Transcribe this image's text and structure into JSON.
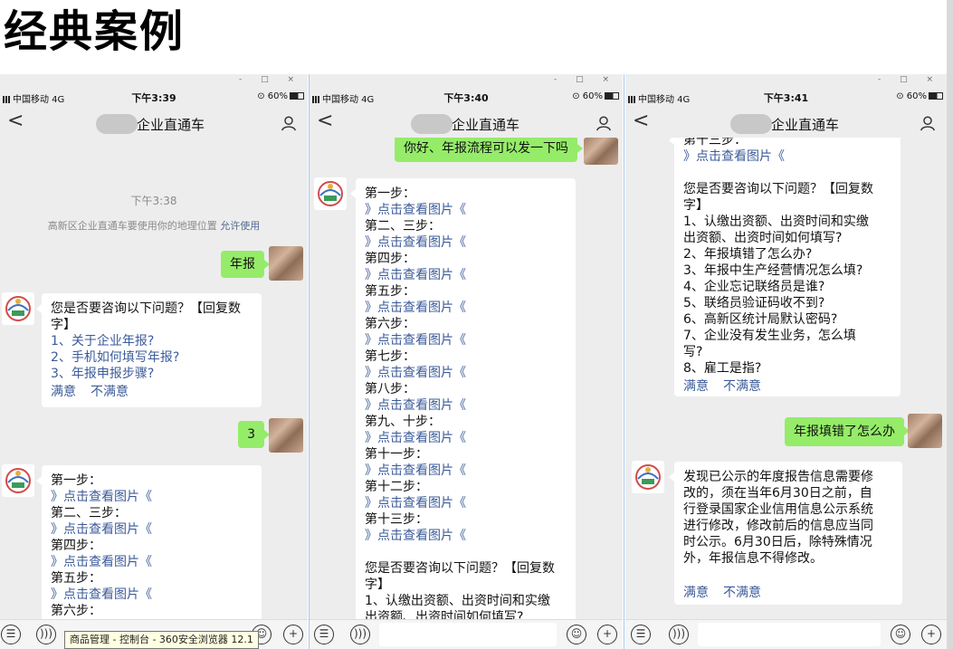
{
  "heading": "经典案例",
  "tooltip": "商品管理 - 控制台 - 360安全浏览器 12.1",
  "window_controls": "-   □   ×",
  "icons": {
    "back": "chevron-left-icon",
    "profile": "person-icon",
    "voice": "voice-icon",
    "menu": "menu-icon",
    "emoji": "emoji-icon",
    "add": "plus-icon"
  },
  "colors": {
    "chat_bg": "#ededed",
    "outgoing_bubble": "#95ec69",
    "link": "#3b5b9a"
  },
  "phones": [
    {
      "carrier": "中国移动  4G",
      "time": "下午3:39",
      "battery": "60%",
      "title": "企业直通车",
      "timestamp": "下午3:38",
      "sysnote": "高新区企业直通车要使用你的地理位置",
      "sysnote_action": "允许使用",
      "msg_out_1": "年报",
      "menu_line_1": "您是否要咨询以下问题？【回复数",
      "menu_line_2": "字】",
      "menu_opt_1": "1、关于企业年报?",
      "menu_opt_2": "2、手机如何填写年报?",
      "menu_opt_3": "3、年报申报步骤?",
      "satisfied": "满意",
      "unsatisfied": "不满意",
      "msg_out_2": "3",
      "steps": [
        {
          "label": "第一步：",
          "link": "》点击查看图片《"
        },
        {
          "label": "第二、三步：",
          "link": "》点击查看图片《"
        },
        {
          "label": "第四步：",
          "link": "》点击查看图片《"
        },
        {
          "label": "第五步：",
          "link": "》点击查看图片《"
        },
        {
          "label": "第六步：",
          "link": ""
        }
      ]
    },
    {
      "carrier": "中国移动  4G",
      "time": "下午3:40",
      "battery": "60%",
      "title": "企业直通车",
      "msg_out_1": "你好、年报流程可以发一下吗",
      "steps": [
        {
          "label": "第一步：",
          "link": "》点击查看图片《"
        },
        {
          "label": "第二、三步：",
          "link": "》点击查看图片《"
        },
        {
          "label": "第四步：",
          "link": "》点击查看图片《"
        },
        {
          "label": "第五步：",
          "link": "》点击查看图片《"
        },
        {
          "label": "第六步：",
          "link": "》点击查看图片《"
        },
        {
          "label": "第七步：",
          "link": "》点击查看图片《"
        },
        {
          "label": "第八步：",
          "link": "》点击查看图片《"
        },
        {
          "label": "第九、十步：",
          "link": "》点击查看图片《"
        },
        {
          "label": "第十一步：",
          "link": "》点击查看图片《"
        },
        {
          "label": "第十二步：",
          "link": "》点击查看图片《"
        },
        {
          "label": "第十三步：",
          "link": "》点击查看图片《"
        }
      ],
      "menu_line_1": "您是否要咨询以下问题？【回复数",
      "menu_line_2": "字】",
      "menu_opt_1a": "1、认缴出资额、出资时间和实缴",
      "menu_opt_1b": "出资额、出资时间如何填写?"
    },
    {
      "carrier": "中国移动  4G",
      "time": "下午3:41",
      "battery": "60%",
      "title": "企业直通车",
      "step_label": "第十三步：",
      "step_link": "》点击查看图片《",
      "menu_line_1": "您是否要咨询以下问题？【回复数",
      "menu_line_2": "字】",
      "menu_opts": [
        "1、认缴出资额、出资时间和实缴",
        "出资额、出资时间如何填写?",
        "2、年报填错了怎么办?",
        "3、年报中生产经营情况怎么填?",
        "4、企业忘记联络员是谁?",
        "5、联络员验证码收不到?",
        "6、高新区统计局默认密码?",
        "7、企业没有发生业务，怎么填",
        "写?",
        "8、雇工是指?"
      ],
      "satisfied": "满意",
      "unsatisfied": "不满意",
      "msg_out_1": "年报填错了怎么办",
      "answer_lines": [
        "发现已公示的年度报告信息需要修",
        "改的，须在当年6月30日之前，自",
        "行登录国家企业信用信息公示系统",
        "进行修改，修改前后的信息应当同",
        "时公示。6月30日后，除特殊情况",
        "外，年报信息不得修改。"
      ],
      "satisfied2": "满意",
      "unsatisfied2": "不满意"
    }
  ]
}
